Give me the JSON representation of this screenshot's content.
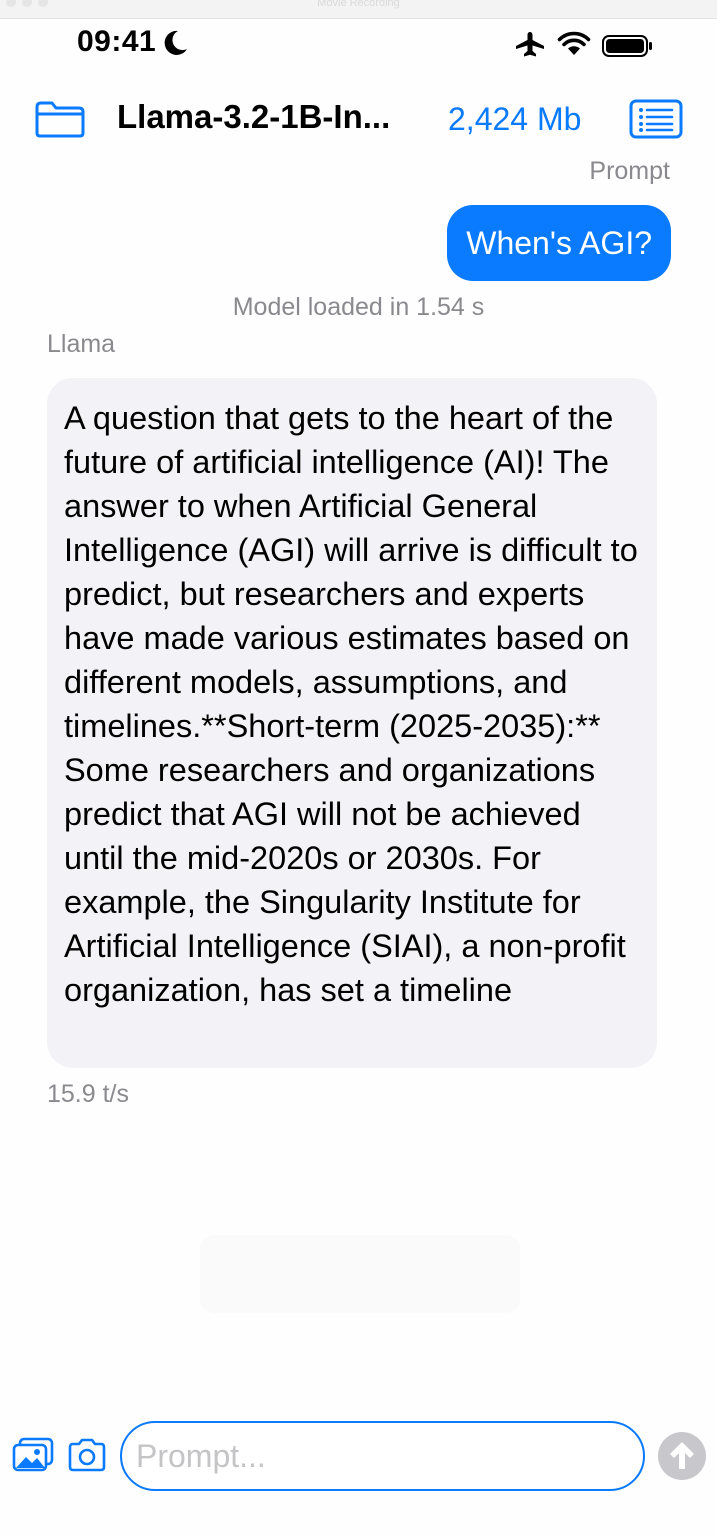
{
  "window": {
    "title": "Movie Recording"
  },
  "status_bar": {
    "time": "09:41",
    "icons": [
      "moon-icon",
      "airplane-icon",
      "wifi-icon",
      "battery-icon"
    ]
  },
  "navbar": {
    "model_name": "Llama-3.2-1B-In...",
    "memory": "2,424 Mb",
    "icons": [
      "folder-icon",
      "list-icon"
    ]
  },
  "conversation": {
    "prompt_caption": "Prompt",
    "user_message": "When's AGI?",
    "load_info": "Model loaded in 1.54 s",
    "assistant_name": "Llama",
    "assistant_message": "A question that gets to the heart of the future of artificial intelligence (AI)! The answer to when Artificial General Intelligence (AGI) will arrive is difficult to predict, but researchers and experts have made various estimates based on different models, assumptions, and timelines.**Short-term (2025-2035):** Some researchers and organizations predict that AGI will not be achieved until the mid-2020s or 2030s. For example, the Singularity Institute for Artificial Intelligence (SIAI), a non-profit organization, has set a timeline",
    "tokens_per_second": "15.9 t/s"
  },
  "input": {
    "placeholder": "Prompt...",
    "value": "",
    "icons": [
      "photo-library-icon",
      "camera-icon",
      "send-arrow-icon"
    ]
  },
  "colors": {
    "accent": "#0a7aff",
    "bubble_gray": "#f3f3f7",
    "secondary_text": "#8a8a8e",
    "send_disabled": "#c7c7cc"
  }
}
